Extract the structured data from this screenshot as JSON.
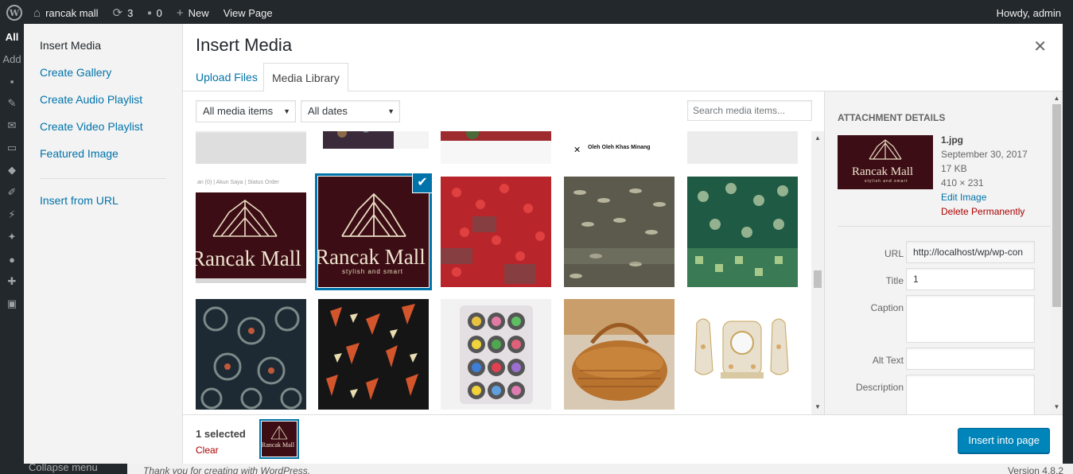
{
  "adminbar": {
    "site_name": "rancak mall",
    "updates_count": "3",
    "comments_count": "0",
    "new_label": "New",
    "view_label": "View Page",
    "howdy": "Howdy, admin",
    "menu_top_label": "All",
    "menu_sub_label": "Add"
  },
  "footer": {
    "thanks": "Thank you for creating with WordPress.",
    "version": "Version 4.8.2",
    "collapse": "Collapse menu"
  },
  "modal": {
    "menu": {
      "items": [
        "Insert Media",
        "Create Gallery",
        "Create Audio Playlist",
        "Create Video Playlist",
        "Featured Image"
      ],
      "url_item": "Insert from URL"
    },
    "title": "Insert Media",
    "close_icon": "close-icon",
    "tabs": [
      "Upload Files",
      "Media Library"
    ],
    "filters": {
      "type": "All media items",
      "date": "All dates",
      "search_placeholder": "Search media items..."
    },
    "grid": {
      "top_row_text": "Oleh Oleh Khas Minang",
      "screenshot_nav": [
        "an (0)",
        "Akun Saya",
        "Status Order"
      ]
    },
    "logo": {
      "brand": "Rancak Mall",
      "tagline": "stylish and smart"
    },
    "details": {
      "heading": "ATTACHMENT DETAILS",
      "filename": "1.jpg",
      "date": "September 30, 2017",
      "filesize": "17 KB",
      "dimensions": "410 × 231",
      "edit_link": "Edit Image",
      "delete_link": "Delete Permanently",
      "fields": {
        "url_label": "URL",
        "url_value": "http://localhost/wp/wp-con",
        "title_label": "Title",
        "title_value": "1",
        "caption_label": "Caption",
        "alt_label": "Alt Text",
        "description_label": "Description"
      }
    },
    "bottom": {
      "selected": "1 selected",
      "clear": "Clear",
      "insert_button": "Insert into page"
    }
  },
  "colors": {
    "accent": "#0073aa",
    "button": "#0085ba",
    "danger": "#a00",
    "logo_bg": "#3c0d14"
  }
}
